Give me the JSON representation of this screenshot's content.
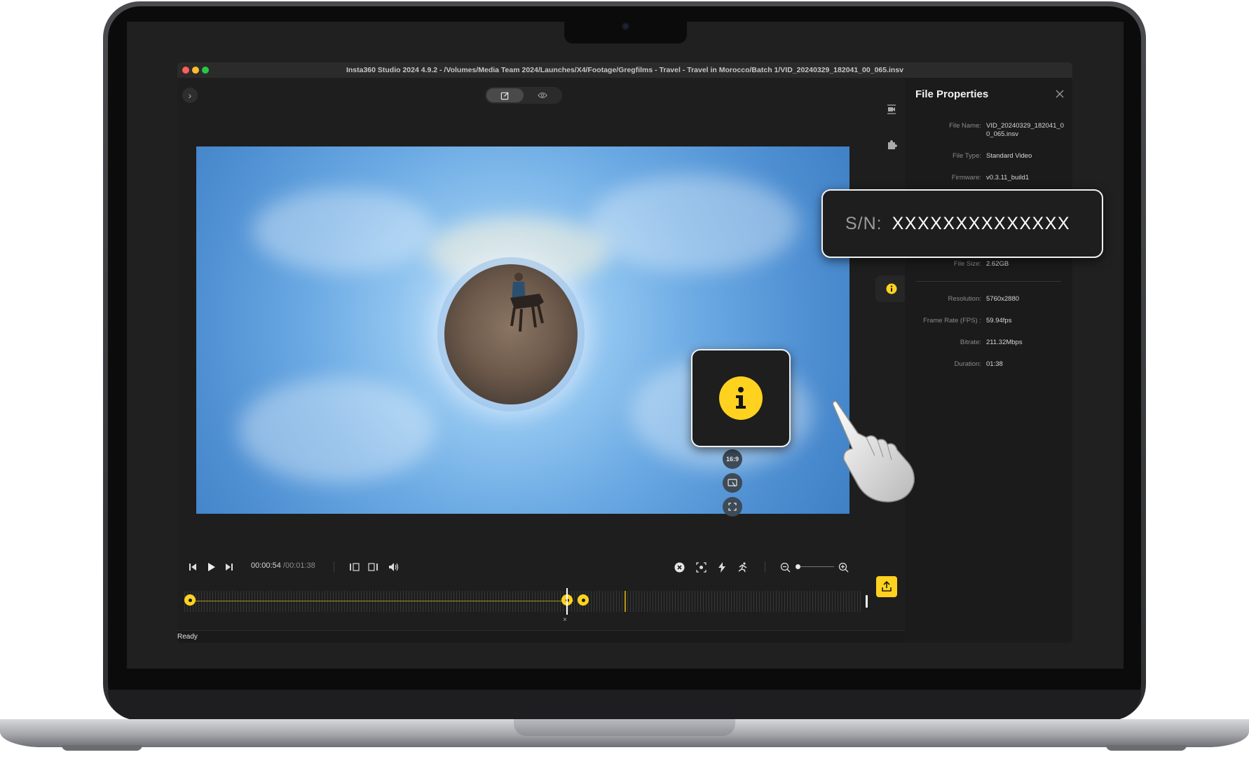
{
  "window": {
    "title": "Insta360 Studio 2024 4.9.2 - /Volumes/Media Team 2024/Launches/X4/Footage/Gregfilms - Travel - Travel in Morocco/Batch 1/VID_20240329_182041_00_065.insv"
  },
  "top_toolbar": {
    "expand_icon": "chevron-right-icon",
    "modes": [
      {
        "icon": "edit-icon",
        "active": true
      },
      {
        "icon": "eye-icon",
        "active": false
      }
    ]
  },
  "video_overlay": {
    "aspect_ratio_label": "16:9"
  },
  "right_rail": {
    "items": [
      {
        "icon": "camera-stabilize-icon"
      },
      {
        "icon": "plugin-icon"
      },
      {
        "icon": "file-icon"
      },
      {
        "icon": "info-icon",
        "active": true
      }
    ]
  },
  "playback": {
    "current_time": "00:00:54",
    "total_time": "/00:01:38"
  },
  "status": {
    "text": "Ready"
  },
  "file_properties": {
    "title": "File Properties",
    "props": [
      {
        "key": "File Name:",
        "value": "VID_20240329_182041_00_065.insv"
      },
      {
        "key": "File Type:",
        "value": "Standard Video"
      },
      {
        "key": "Firmware:",
        "value": "v0.3.11_build1"
      },
      {
        "key": "File Size:",
        "value": "2.62GB"
      },
      {
        "key": "Resolution:",
        "value": "5760x2880"
      },
      {
        "key": "Frame Rate (FPS) :",
        "value": "59.94fps"
      },
      {
        "key": "Bitrate:",
        "value": "211.32Mbps"
      },
      {
        "key": "Duration:",
        "value": "01:38"
      }
    ]
  },
  "callouts": {
    "serial_label": "S/N:",
    "serial_value": "XXXXXXXXXXXXXX",
    "info_icon": "info-icon"
  },
  "colors": {
    "accent": "#ffd21f",
    "background": "#1d1d1d",
    "panel": "#1b1b1b"
  }
}
